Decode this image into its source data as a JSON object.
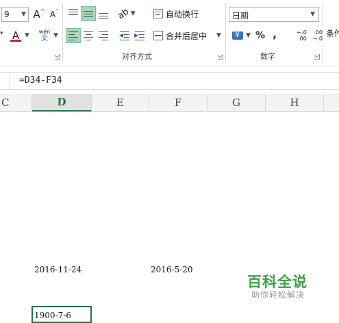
{
  "ribbon": {
    "font_size_value": "9",
    "increase_font_label": "A",
    "decrease_font_label": "A",
    "font_color_label": "A",
    "phonetic_top": "wén",
    "phonetic_bottom": "文",
    "wrap_text_label": "自动换行",
    "merge_center_label": "合并后居中",
    "alignment_group_label": "对齐方式",
    "number_format_value": "日期",
    "percent_label": "%",
    "comma_label": ",",
    "increase_decimal_label": "←.0\n.00",
    "decrease_decimal_label": ".00\n→.0",
    "number_group_label": "数字",
    "conditional_partial": "条件"
  },
  "formula_bar": {
    "formula": "=D34-F34"
  },
  "columns": [
    "C",
    "D",
    "E",
    "F",
    "G",
    "H"
  ],
  "selected_column": "D",
  "cells": {
    "d_date": "2016-11-24",
    "f_date": "2016-5-20",
    "d_result": "1900-7-6"
  },
  "watermark": {
    "title": "百科全说",
    "subtitle": "助你轻松解决"
  },
  "colors": {
    "accent": "#217346",
    "active_button": "#a6d8bc",
    "font_color_bar": "#e81123"
  }
}
